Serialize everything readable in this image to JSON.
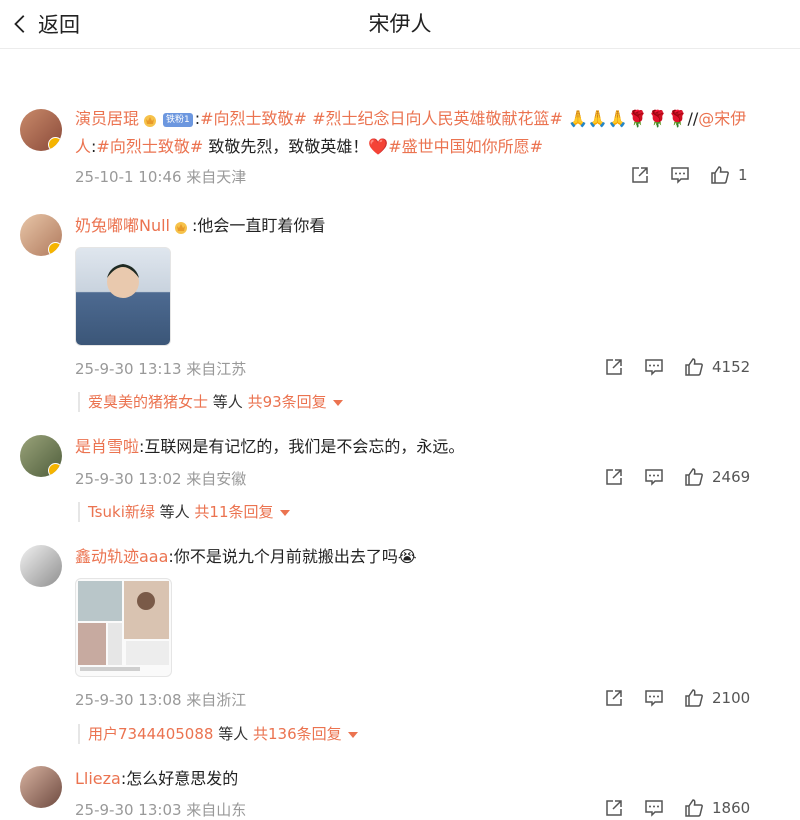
{
  "header": {
    "back_label": "返回",
    "title": "宋伊人"
  },
  "comments": [
    {
      "user": "演员居琨",
      "badge": "铁粉1",
      "text_before": ":",
      "tags": [
        "#向烈士致敬#",
        "#烈士纪念日向人民英雄敬献花篮#"
      ],
      "line1_tail": "🙏🙏🙏🌹🌹🌹//",
      "mention_a": "@宋伊",
      "mention_b": "人",
      "line2_sep": ":",
      "tag2": "#向烈士致敬#",
      "text2": " 致敬先烈，致敬英雄！",
      "heart": "❤️",
      "tag3": "#盛世中国如你所愿#",
      "meta": "25-10-1 10:46 来自天津",
      "likes": "1"
    },
    {
      "user": "奶兔嘟嘟Null",
      "text": ":他会一直盯着你看",
      "meta": "25-9-30 13:13 来自江苏",
      "likes": "4152",
      "reply_user": "爱臭美的猪猪女士",
      "reply_mid": " 等人 ",
      "reply_count": "共93条回复"
    },
    {
      "user": "是肖雪啦",
      "text": ":互联网是有记忆的，我们是不会忘的，永远。",
      "meta": "25-9-30 13:02 来自安徽",
      "likes": "2469",
      "reply_user": "Tsuki新绿",
      "reply_mid": " 等人 ",
      "reply_count": "共11条回复"
    },
    {
      "user": "鑫动轨迹aaa",
      "text": ":你不是说九个月前就搬出去了吗",
      "emoji": "😭",
      "meta": "25-9-30 13:08 来自浙江",
      "likes": "2100",
      "reply_user": "用户7344405088",
      "reply_mid": " 等人 ",
      "reply_count": "共136条回复"
    },
    {
      "user": "Llieza",
      "text": ":怎么好意思发的",
      "meta": "25-9-30 13:03 来自山东",
      "likes": "1860"
    }
  ],
  "colors": {
    "accent": "#eb7350",
    "meta": "#999999",
    "badge": "#6c97df",
    "verify": "#f5b400"
  },
  "icons": [
    "chevron-left-icon",
    "share-icon",
    "comment-icon",
    "like-icon",
    "crown-icon",
    "verified-icon",
    "caret-down-icon"
  ]
}
